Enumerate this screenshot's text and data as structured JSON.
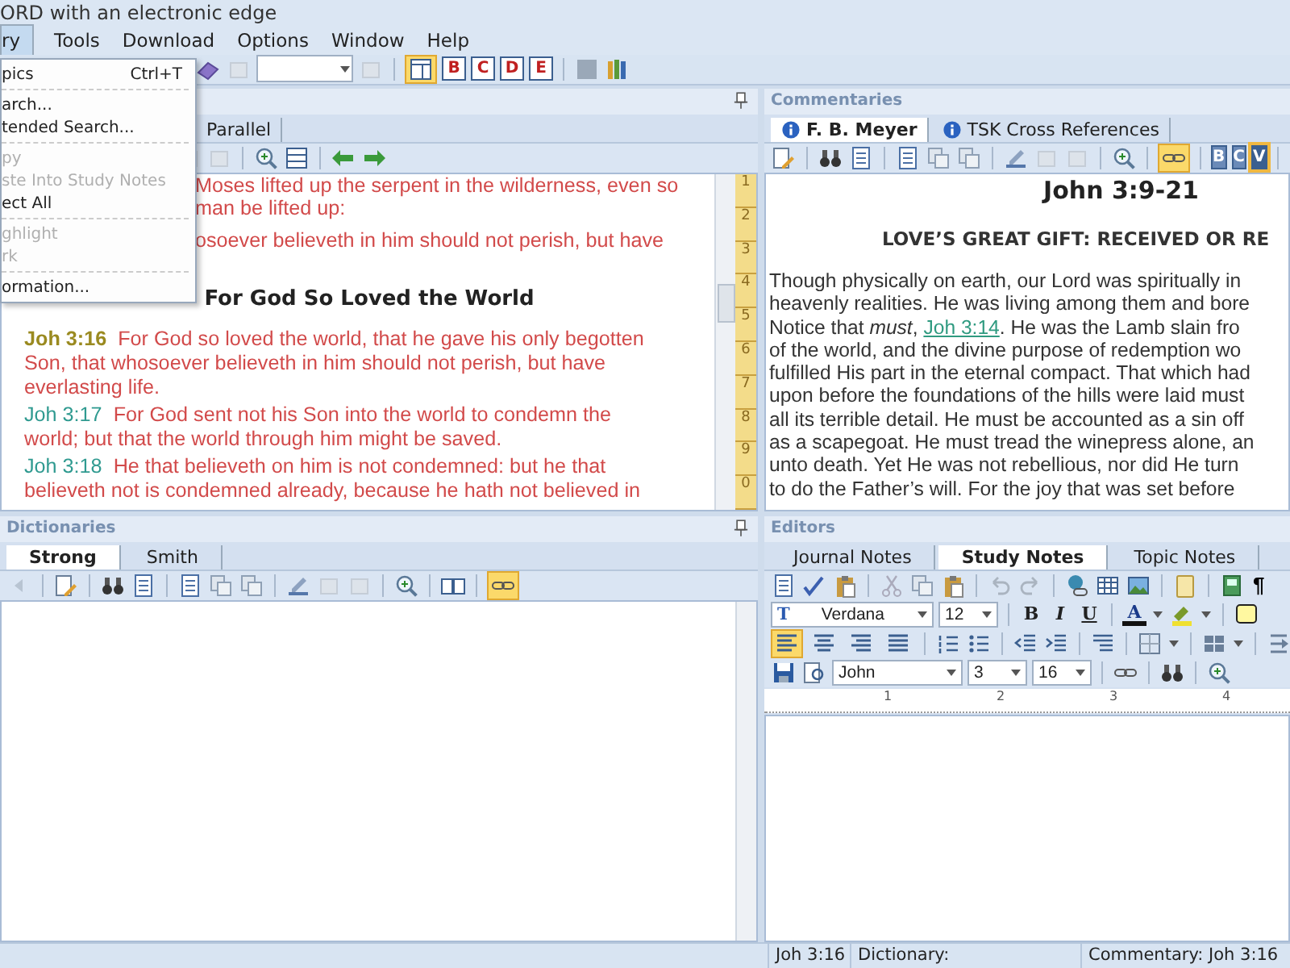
{
  "window": {
    "title": "ORD with an electronic edge"
  },
  "menu": [
    {
      "label": "ry",
      "selected": true
    },
    {
      "label": "Tools",
      "selected": false
    },
    {
      "label": "Download",
      "selected": false
    },
    {
      "label": "Options",
      "selected": false
    },
    {
      "label": "Window",
      "selected": false
    },
    {
      "label": "Help",
      "selected": false
    }
  ],
  "dropdown": [
    {
      "kind": "item",
      "label": "pics",
      "shortcut": "Ctrl+T",
      "disabled": false
    },
    {
      "kind": "separator"
    },
    {
      "kind": "item",
      "label": "arch...",
      "disabled": false
    },
    {
      "kind": "item",
      "label": "tended Search...",
      "disabled": false
    },
    {
      "kind": "separator"
    },
    {
      "kind": "item",
      "label": "py",
      "disabled": true
    },
    {
      "kind": "item",
      "label": "ste Into Study Notes",
      "disabled": true
    },
    {
      "kind": "item",
      "label": "ect All",
      "disabled": false
    },
    {
      "kind": "separator"
    },
    {
      "kind": "item",
      "label": "ghlight",
      "disabled": true
    },
    {
      "kind": "item",
      "label": "rk",
      "disabled": true
    },
    {
      "kind": "separator"
    },
    {
      "kind": "item",
      "label": "ormation...",
      "disabled": false
    }
  ],
  "toolbar": {
    "layout_selected": true,
    "letter_buttons": [
      {
        "label": "B"
      },
      {
        "label": "C"
      },
      {
        "label": "D"
      },
      {
        "label": "E"
      }
    ]
  },
  "bible": {
    "tabs": [
      {
        "label": "Parallel",
        "selected": false
      }
    ],
    "partial_verses": [
      {
        "lines": [
          "Moses lifted up the serpent in the wilderness, even so",
          "man be lifted up:"
        ]
      },
      {
        "lines": [
          "osoever believeth in him should not perish, but have"
        ]
      }
    ],
    "heading": "For God So Loved the World",
    "verses": [
      {
        "ref": "Joh 3:16",
        "text": "For God so loved the world, that he gave his only begotten Son, that whosoever believeth in him should not perish, but have everlasting life.",
        "current": true
      },
      {
        "ref": "Joh 3:17",
        "text": "For God sent not his Son into the world to condemn the world; but that the world through him might be saved.",
        "current": false
      },
      {
        "ref": "Joh 3:18",
        "text": "He that believeth on him is not condemned: but he that believeth not is condemned already, because he hath not believed in",
        "current": false
      }
    ],
    "book_tabs": [
      "1",
      "2",
      "3",
      "4",
      "5",
      "6",
      "7",
      "8",
      "9",
      "0"
    ]
  },
  "commentaries": {
    "title": "Commentaries",
    "tabs": [
      {
        "label": "F. B. Meyer",
        "selected": true
      },
      {
        "label": "TSK Cross References",
        "selected": false
      }
    ],
    "link_active": true,
    "letter_buttons": [
      {
        "label": "B",
        "selected": false
      },
      {
        "label": "C",
        "selected": false
      },
      {
        "label": "V",
        "selected": true
      }
    ],
    "heading": "John 3:9-21",
    "subheading": "LOVE’S GREAT GIFT: RECEIVED OR RE",
    "lines": [
      {
        "text": "Though physically on earth, our Lord was spiritually in"
      },
      {
        "text": "heavenly realities. He was living among them and bore"
      },
      {
        "text": "Notice that *must*, ",
        "link": "Joh 3:14",
        "after": ". He was the Lamb slain fro"
      },
      {
        "text": "of the world, and the divine purpose of redemption wo"
      },
      {
        "text": "fulfilled His part in the eternal compact. That which had"
      },
      {
        "text": "upon before the foundations of the hills were laid must"
      },
      {
        "text": "all its terrible detail. He must be accounted as a sin off"
      },
      {
        "text": "as a scapegoat. He must tread the winepress alone, an"
      },
      {
        "text": "unto death. Yet He was not rebellious, nor did He turn"
      },
      {
        "text": "to do the Father’s will. For the joy that was set before"
      }
    ]
  },
  "dictionaries": {
    "title": "Dictionaries",
    "tabs": [
      {
        "label": "Strong",
        "selected": true
      },
      {
        "label": "Smith",
        "selected": false
      }
    ],
    "link_active": true
  },
  "editors": {
    "title": "Editors",
    "tabs": [
      {
        "label": "Journal Notes",
        "selected": false
      },
      {
        "label": "Study Notes",
        "selected": true
      },
      {
        "label": "Topic Notes",
        "selected": false
      }
    ],
    "pilcrow": "¶",
    "font_glyph": "T",
    "font": "Verdana",
    "size": "12",
    "format_buttons": [
      "B",
      "I",
      "U"
    ],
    "color_button": "A",
    "align_buttons": [
      {
        "kind": "left",
        "selected": true
      },
      {
        "kind": "center",
        "selected": false
      },
      {
        "kind": "right",
        "selected": false
      },
      {
        "kind": "justify",
        "selected": false
      }
    ],
    "book": "John",
    "chapter": "3",
    "verse": "16",
    "ruler": [
      "1",
      "2",
      "3",
      "4"
    ]
  },
  "status_bar": [
    "Joh 3:16",
    "Dictionary:",
    "Commentary: Joh 3:16"
  ]
}
